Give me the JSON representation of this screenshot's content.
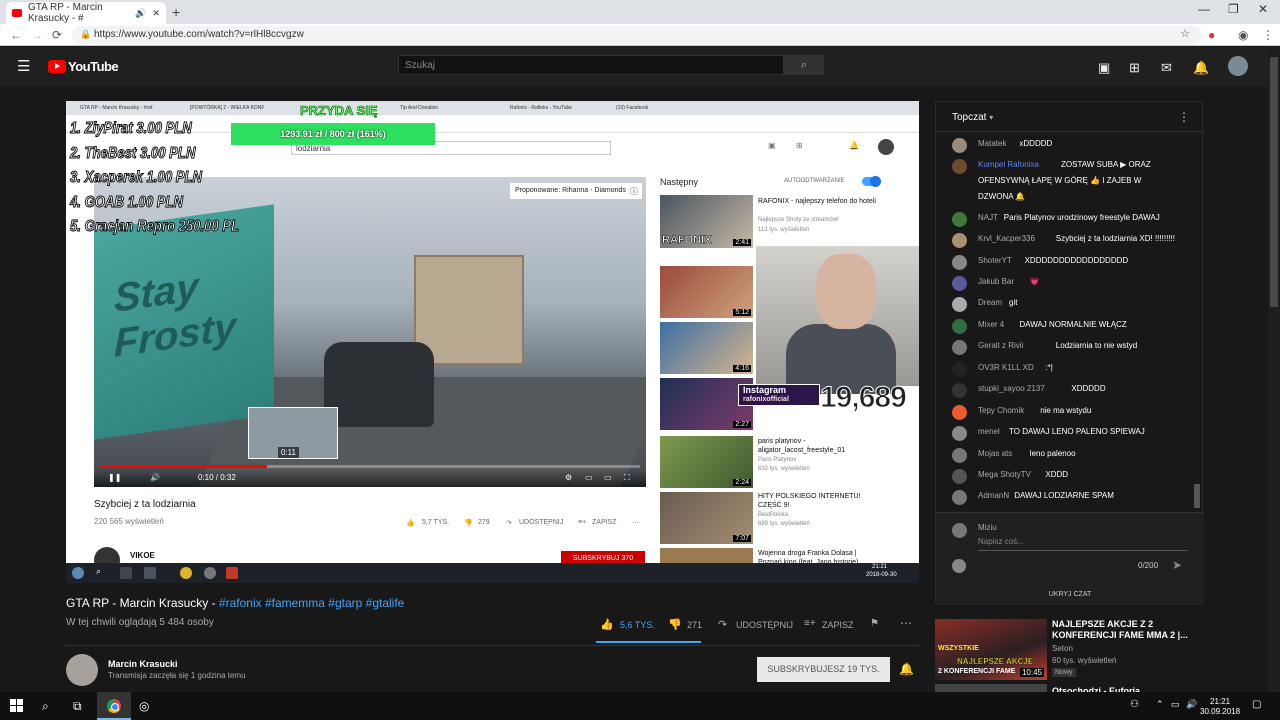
{
  "browser": {
    "tab_title": "GTA RP - Marcin Krasucky - #",
    "new_tab": "+",
    "url": "https://www.youtube.com/watch?v=rlHl8ccvgzw",
    "minimize": "—",
    "maximize": "❐",
    "close": "✕"
  },
  "yt_header": {
    "logo_text": "YouTube",
    "search_placeholder": "Szukaj"
  },
  "video": {
    "inner_tabs": [
      "GTA RP - Marcin Krasucky - #raf",
      "[POWTÓRKA] 2 - WIELKA KONF",
      "PRZYDA SIĘ",
      "Tip And Donation",
      "Rafonix - Rafleks - YouTube",
      "(10) Facebook"
    ],
    "inner_search": "lodziarnia",
    "donate_title": "PRZYDA SIĘ",
    "donate_bar": "1293.91 zł / 800 zł (161%)",
    "donate_progress": 1.61,
    "overlay_list": [
      "1. ZiyPirat 3.00 PLN",
      "2. TheBest 3.00 PLN",
      "3. Xacperek 1.00 PLN",
      "4. GOAB 1.00 PLN",
      "5. Gracjan Repro 250.00 PL"
    ],
    "proponowane": "Proponowane: Rihanna - Diamonds",
    "truck_text": "Stay Frosty",
    "preview_time": "0:11",
    "time": "0:10 / 0:32",
    "progress": 0.31,
    "inner_title": "Szybciej z ta lodziarnia",
    "inner_views": "220 565 wyświetleń",
    "inner_likes": "5,7 TYS.",
    "inner_dislikes": "279",
    "inner_share": "UDOSTĘPNIJ",
    "inner_save": "ZAPISZ",
    "inner_channel": "VIKOE",
    "inner_subscribe": "SUBSKRYBUJ 370",
    "next_label": "Następny",
    "autoplay_label": "AUTOODTWARZANIE",
    "recs": [
      {
        "title": "RAFONIX - najlepszy telefon do hoteli",
        "sub": "Najlepsze Shoty ze streamów!",
        "sub2": "113 tys. wyświetleń",
        "dur": "2:41",
        "thumb_label": "RAFONIX"
      },
      {
        "title": "",
        "sub": "",
        "sub2": "",
        "dur": "5:12"
      },
      {
        "title": "",
        "sub": "",
        "sub2": "",
        "dur": "4:16"
      },
      {
        "title": "",
        "sub": "",
        "sub2": "",
        "dur": "2:27"
      },
      {
        "title": "paris platynov - aligator_lacost_freestyle_01",
        "sub": "Paris Platynov",
        "sub2": "632 tys. wyświetleń",
        "dur": "2:24"
      },
      {
        "title": "HITY POLSKIEGO INTERNETU! CZĘŚĆ 9!",
        "sub": "BestPolska",
        "sub2": "689 tys. wyświetleń",
        "dur": "7:07"
      },
      {
        "title": "Wojenna droga Franka Dolasa | Poznań kino (feat. Jano historie)",
        "sub": "",
        "sub2": "",
        "dur": ""
      }
    ],
    "instagram_label": "Instagram",
    "instagram_handle": "rafonixofficial",
    "viewer_count": "19,689",
    "rec_clock_time": "21:21",
    "rec_clock_date": "2018-09-30"
  },
  "page": {
    "title_main": "GTA RP - Marcin Krasucky - ",
    "title_tags": "#rafonix #famemma #gtarp #gtalife",
    "watching": "W tej chwili oglądają 5 484 osoby",
    "likes": "5,6 TYS.",
    "like_ratio": 0.95,
    "dislikes": "271",
    "share": "UDOSTĘPNIJ",
    "save": "ZAPISZ",
    "channel_name": "Marcin Krasucki",
    "channel_sub": "Transmisja zaczęła się 1 godzina temu",
    "subscribed": "SUBSKRYBUJESZ  19 TYS."
  },
  "chat": {
    "header": "Topczat",
    "messages": [
      {
        "author": "Matatek",
        "text": "xDDDDD"
      },
      {
        "author": "Kumpel Rafonixa",
        "text": "ZOSTAW SUBA ▶ ORAZ",
        "cont": "OFENSYWNĄ ŁAPĘ W GÓRĘ 👍 I ZAJEB W",
        "cont2": "DZWONA 🔔"
      },
      {
        "author": "NAJT",
        "text": "Paris Platynov urodzinowy freestyle DAWAJ"
      },
      {
        "author": "Krvl_Kacper336",
        "text": "Szybciej z ta lodziarnia XD! !!!!!!!!!"
      },
      {
        "author": "ShoterYT",
        "text": "XDDDDDDDDDDDDDDDDD"
      },
      {
        "author": "Jakub Bar",
        "text": "💗"
      },
      {
        "author": "Dream",
        "text": "git"
      },
      {
        "author": "Mixer 4",
        "text": "DAWAJ NORMALNIE WŁĄCZ"
      },
      {
        "author": "Geralt z Rivii",
        "text": "Lodziarnia to nie wstyd"
      },
      {
        "author": "OV3R K1LL XD",
        "text": ":*|"
      },
      {
        "author": "stupki_xayoo 2137",
        "text": "XDDDDD"
      },
      {
        "author": "Tepy Chomik",
        "text": "nie ma wstydu"
      },
      {
        "author": "menel",
        "text": "TO DAWAJ LENO PALENO SPIEWAJ"
      },
      {
        "author": "Mojas ats",
        "text": "leno palenoo"
      },
      {
        "author": "Mega ShotyTV",
        "text": "XDDD"
      },
      {
        "author": "AdmanN",
        "text": "DAWAJ LODZIARNE SPAM"
      }
    ],
    "current_user": "Miziu",
    "input_placeholder": "Napisz coś...",
    "counter": "0/200",
    "hide": "UKRYJ CZAT",
    "avatar_colors": [
      "#9c8a7b",
      "#6d4c2e",
      "#3d7a3a",
      "#a89070",
      "#888",
      "#5a5a9a",
      "#aaa",
      "#2f6f3f",
      "#777",
      "#222",
      "#333",
      "#e65c2e",
      "#888",
      "#777",
      "#555",
      "#777"
    ]
  },
  "recommendation": {
    "title": "NAJLEPSZE AKCJE Z 2 KONFERENCJI FAME MMA 2 |...",
    "channel": "Seton",
    "views": "60 tys. wyświetleń",
    "badge": "Nowy",
    "duration": "10:45",
    "thumb_text": "NAJLEPSZE AKCJE",
    "thumb_text2": "WSZYSTKIE",
    "thumb_text3": "2 KONFERENCJI FAME",
    "next_title": "Otsochodzi - Euforia"
  },
  "taskbar": {
    "time": "21:21",
    "date": "30.09.2018"
  },
  "colors": {
    "accent": "#3ea6ff",
    "brand_red": "#ff0000",
    "background": "#181818"
  }
}
